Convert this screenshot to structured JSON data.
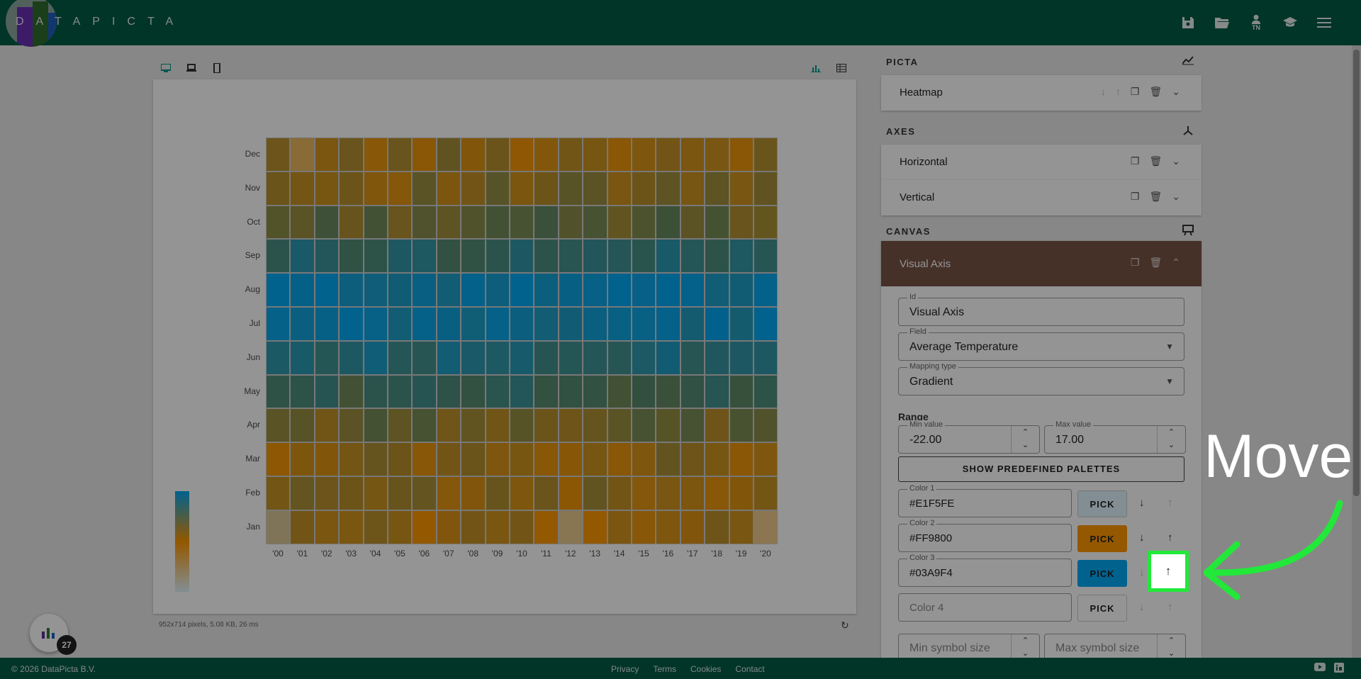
{
  "app": {
    "logo_text": "DATAPICTA",
    "user_initials": "TN"
  },
  "preview": {
    "stats": "952x714 pixels, 5.08 KB, 26 ms",
    "badge_count": "27"
  },
  "heatmap": {
    "months": [
      "Dec",
      "Nov",
      "Oct",
      "Sep",
      "Aug",
      "Jul",
      "Jun",
      "May",
      "Apr",
      "Mar",
      "Feb",
      "Jan"
    ],
    "years": [
      "'00",
      "'01",
      "'02",
      "'03",
      "'04",
      "'05",
      "'06",
      "'07",
      "'08",
      "'09",
      "'10",
      "'11",
      "'12",
      "'13",
      "'14",
      "'15",
      "'16",
      "'17",
      "'18",
      "'19",
      "'20"
    ],
    "colors": {
      "cold": "#03A9F4",
      "warm": "#FF9800",
      "light": "#E1F5FE",
      "mid_green": "#5b8a6a"
    }
  },
  "panel": {
    "picta_title": "PICTA",
    "axes_title": "AXES",
    "canvas_title": "CANVAS",
    "picta_items": [
      "Heatmap"
    ],
    "axes_items": [
      "Horizontal",
      "Vertical"
    ],
    "canvas_items": [
      "Visual Axis"
    ],
    "visual_axis": {
      "id_label": "Id",
      "id_value": "Visual Axis",
      "field_label": "Field",
      "field_value": "Average Temperature",
      "mapping_label": "Mapping type",
      "mapping_value": "Gradient",
      "range_title": "Range",
      "min_label": "Min value",
      "min_value": "-22.00",
      "max_label": "Max value",
      "max_value": "17.00",
      "palettes_button": "SHOW PREDEFINED PALETTES",
      "pick_label": "PICK",
      "colors": [
        {
          "label": "Color 1",
          "value": "#E1F5FE",
          "swatch": "#E1F5FE"
        },
        {
          "label": "Color 2",
          "value": "#FF9800",
          "swatch": "#FF9800"
        },
        {
          "label": "Color 3",
          "value": "#03A9F4",
          "swatch": "#03A9F4"
        },
        {
          "label": "",
          "value": "Color 4",
          "swatch": "#ffffff"
        }
      ],
      "min_symbol": "Min symbol size",
      "max_symbol": "Max symbol size"
    }
  },
  "annotation": {
    "text": "Move",
    "highlight_color": "#22e83a"
  },
  "footer": {
    "copyright": "© 2026 DataPicta B.V.",
    "links": [
      "Privacy",
      "Terms",
      "Cookies",
      "Contact"
    ]
  }
}
